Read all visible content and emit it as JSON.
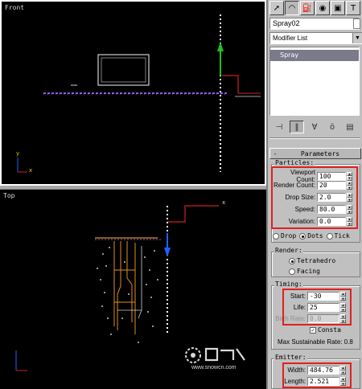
{
  "viewports": {
    "front": {
      "label": "Front"
    },
    "top": {
      "label": "Top",
      "axis_x": "x"
    },
    "axis": {
      "x": "x",
      "y": "y"
    }
  },
  "watermark": {
    "url": "www.snowcn.com"
  },
  "panel": {
    "tabs": [
      "create-icon",
      "modify-icon",
      "hierarchy-icon",
      "motion-icon",
      "display-icon",
      "utilities-icon"
    ],
    "object_name": "Spray02",
    "modifier_list": "Modifier List",
    "stack": [
      "Spray"
    ],
    "rollout": {
      "toggle": "-",
      "title": "Parameters"
    },
    "particles": {
      "label": "Particles:",
      "viewport_count": {
        "label": "Viewport Count:",
        "value": "100"
      },
      "render_count": {
        "label": "Render Count:",
        "value": "20"
      },
      "drop_size": {
        "label": "Drop Size:",
        "value": "2.0"
      },
      "speed": {
        "label": "Speed:",
        "value": "80.0"
      },
      "variation": {
        "label": "Variation:",
        "value": "0.0"
      },
      "shape_drop": "Drop",
      "shape_dots": "Dots",
      "shape_ticks": "Tick"
    },
    "render": {
      "label": "Render:",
      "tetrahedron": "Tetrahedro",
      "facing": "Facing"
    },
    "timing": {
      "label": "Timing:",
      "start": {
        "label": "Start:",
        "value": "-30"
      },
      "life": {
        "label": "Life:",
        "value": "25"
      },
      "birth_rate": {
        "label": "Birth Rate:",
        "value": "0.0"
      },
      "constant": "Consta",
      "max_rate": "Max Sustainable Rate: 0.8"
    },
    "emitter": {
      "label": "Emitter:",
      "width": {
        "label": "Width:",
        "value": "484.76"
      },
      "length": {
        "label": "Length:",
        "value": "2.521"
      }
    }
  },
  "colors": {
    "highlight": "#e02020",
    "viewport_bg": "#000000",
    "panel_bg": "#c0c0c0"
  }
}
